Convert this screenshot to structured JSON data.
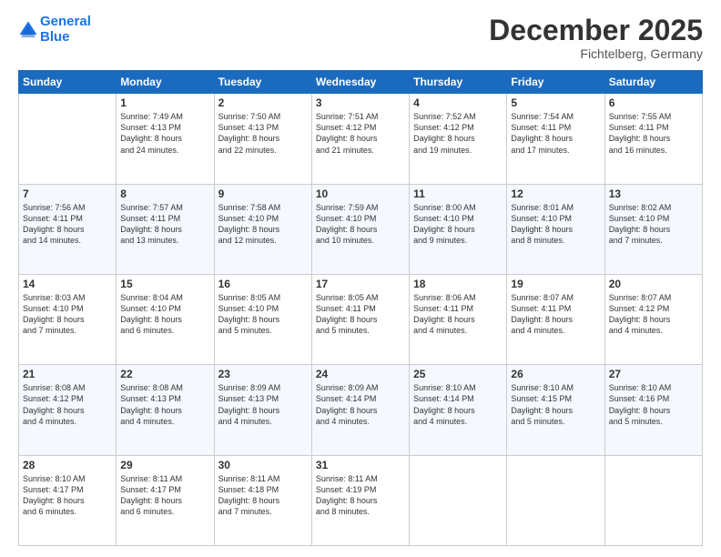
{
  "header": {
    "logo_line1": "General",
    "logo_line2": "Blue",
    "title": "December 2025",
    "subtitle": "Fichtelberg, Germany"
  },
  "days_of_week": [
    "Sunday",
    "Monday",
    "Tuesday",
    "Wednesday",
    "Thursday",
    "Friday",
    "Saturday"
  ],
  "weeks": [
    [
      {
        "day": "",
        "text": ""
      },
      {
        "day": "1",
        "text": "Sunrise: 7:49 AM\nSunset: 4:13 PM\nDaylight: 8 hours\nand 24 minutes."
      },
      {
        "day": "2",
        "text": "Sunrise: 7:50 AM\nSunset: 4:13 PM\nDaylight: 8 hours\nand 22 minutes."
      },
      {
        "day": "3",
        "text": "Sunrise: 7:51 AM\nSunset: 4:12 PM\nDaylight: 8 hours\nand 21 minutes."
      },
      {
        "day": "4",
        "text": "Sunrise: 7:52 AM\nSunset: 4:12 PM\nDaylight: 8 hours\nand 19 minutes."
      },
      {
        "day": "5",
        "text": "Sunrise: 7:54 AM\nSunset: 4:11 PM\nDaylight: 8 hours\nand 17 minutes."
      },
      {
        "day": "6",
        "text": "Sunrise: 7:55 AM\nSunset: 4:11 PM\nDaylight: 8 hours\nand 16 minutes."
      }
    ],
    [
      {
        "day": "7",
        "text": "Sunrise: 7:56 AM\nSunset: 4:11 PM\nDaylight: 8 hours\nand 14 minutes."
      },
      {
        "day": "8",
        "text": "Sunrise: 7:57 AM\nSunset: 4:11 PM\nDaylight: 8 hours\nand 13 minutes."
      },
      {
        "day": "9",
        "text": "Sunrise: 7:58 AM\nSunset: 4:10 PM\nDaylight: 8 hours\nand 12 minutes."
      },
      {
        "day": "10",
        "text": "Sunrise: 7:59 AM\nSunset: 4:10 PM\nDaylight: 8 hours\nand 10 minutes."
      },
      {
        "day": "11",
        "text": "Sunrise: 8:00 AM\nSunset: 4:10 PM\nDaylight: 8 hours\nand 9 minutes."
      },
      {
        "day": "12",
        "text": "Sunrise: 8:01 AM\nSunset: 4:10 PM\nDaylight: 8 hours\nand 8 minutes."
      },
      {
        "day": "13",
        "text": "Sunrise: 8:02 AM\nSunset: 4:10 PM\nDaylight: 8 hours\nand 7 minutes."
      }
    ],
    [
      {
        "day": "14",
        "text": "Sunrise: 8:03 AM\nSunset: 4:10 PM\nDaylight: 8 hours\nand 7 minutes."
      },
      {
        "day": "15",
        "text": "Sunrise: 8:04 AM\nSunset: 4:10 PM\nDaylight: 8 hours\nand 6 minutes."
      },
      {
        "day": "16",
        "text": "Sunrise: 8:05 AM\nSunset: 4:10 PM\nDaylight: 8 hours\nand 5 minutes."
      },
      {
        "day": "17",
        "text": "Sunrise: 8:05 AM\nSunset: 4:11 PM\nDaylight: 8 hours\nand 5 minutes."
      },
      {
        "day": "18",
        "text": "Sunrise: 8:06 AM\nSunset: 4:11 PM\nDaylight: 8 hours\nand 4 minutes."
      },
      {
        "day": "19",
        "text": "Sunrise: 8:07 AM\nSunset: 4:11 PM\nDaylight: 8 hours\nand 4 minutes."
      },
      {
        "day": "20",
        "text": "Sunrise: 8:07 AM\nSunset: 4:12 PM\nDaylight: 8 hours\nand 4 minutes."
      }
    ],
    [
      {
        "day": "21",
        "text": "Sunrise: 8:08 AM\nSunset: 4:12 PM\nDaylight: 8 hours\nand 4 minutes."
      },
      {
        "day": "22",
        "text": "Sunrise: 8:08 AM\nSunset: 4:13 PM\nDaylight: 8 hours\nand 4 minutes."
      },
      {
        "day": "23",
        "text": "Sunrise: 8:09 AM\nSunset: 4:13 PM\nDaylight: 8 hours\nand 4 minutes."
      },
      {
        "day": "24",
        "text": "Sunrise: 8:09 AM\nSunset: 4:14 PM\nDaylight: 8 hours\nand 4 minutes."
      },
      {
        "day": "25",
        "text": "Sunrise: 8:10 AM\nSunset: 4:14 PM\nDaylight: 8 hours\nand 4 minutes."
      },
      {
        "day": "26",
        "text": "Sunrise: 8:10 AM\nSunset: 4:15 PM\nDaylight: 8 hours\nand 5 minutes."
      },
      {
        "day": "27",
        "text": "Sunrise: 8:10 AM\nSunset: 4:16 PM\nDaylight: 8 hours\nand 5 minutes."
      }
    ],
    [
      {
        "day": "28",
        "text": "Sunrise: 8:10 AM\nSunset: 4:17 PM\nDaylight: 8 hours\nand 6 minutes."
      },
      {
        "day": "29",
        "text": "Sunrise: 8:11 AM\nSunset: 4:17 PM\nDaylight: 8 hours\nand 6 minutes."
      },
      {
        "day": "30",
        "text": "Sunrise: 8:11 AM\nSunset: 4:18 PM\nDaylight: 8 hours\nand 7 minutes."
      },
      {
        "day": "31",
        "text": "Sunrise: 8:11 AM\nSunset: 4:19 PM\nDaylight: 8 hours\nand 8 minutes."
      },
      {
        "day": "",
        "text": ""
      },
      {
        "day": "",
        "text": ""
      },
      {
        "day": "",
        "text": ""
      }
    ]
  ]
}
